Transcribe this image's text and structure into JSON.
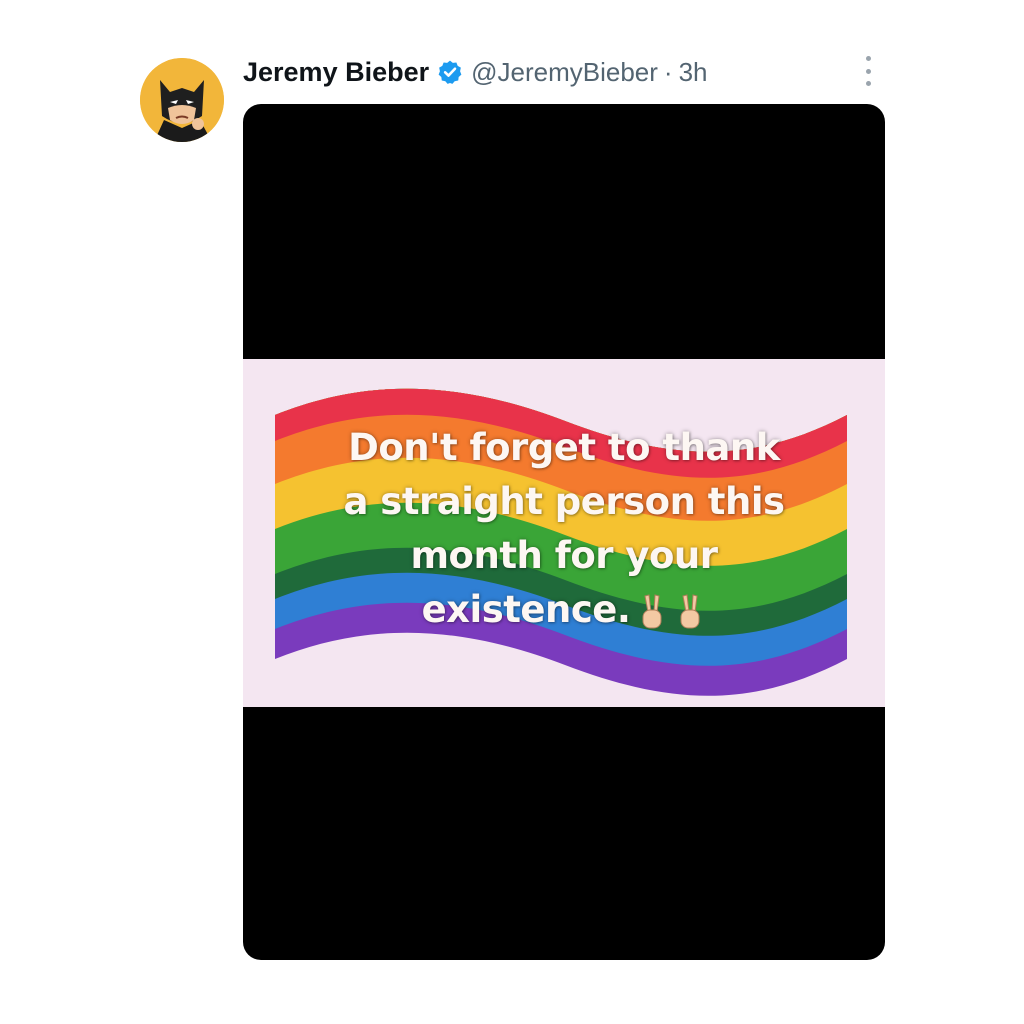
{
  "tweet": {
    "author": {
      "name": "Jeremy Bieber",
      "handle": "@JeremyBieber",
      "verified": true,
      "avatar_icon": "batman-avatar-icon"
    },
    "separator": "·",
    "time": "3h",
    "more_icon": "more-vertical-icon",
    "media": {
      "caption_lines": [
        "Don't forget to thank",
        "a straight person this",
        "month for your",
        "existence."
      ],
      "emoji": "peace-hand-icon",
      "flag_colors": [
        "#e8334a",
        "#f47a2e",
        "#f5c230",
        "#3aa537",
        "#1e6f3b",
        "#2f7fd4",
        "#6a3bbd",
        "#8b3dbd"
      ]
    }
  },
  "colors": {
    "name": "#0f1419",
    "muted": "#536471",
    "verified": "#1d9bf0",
    "media_bg": "#000000"
  }
}
